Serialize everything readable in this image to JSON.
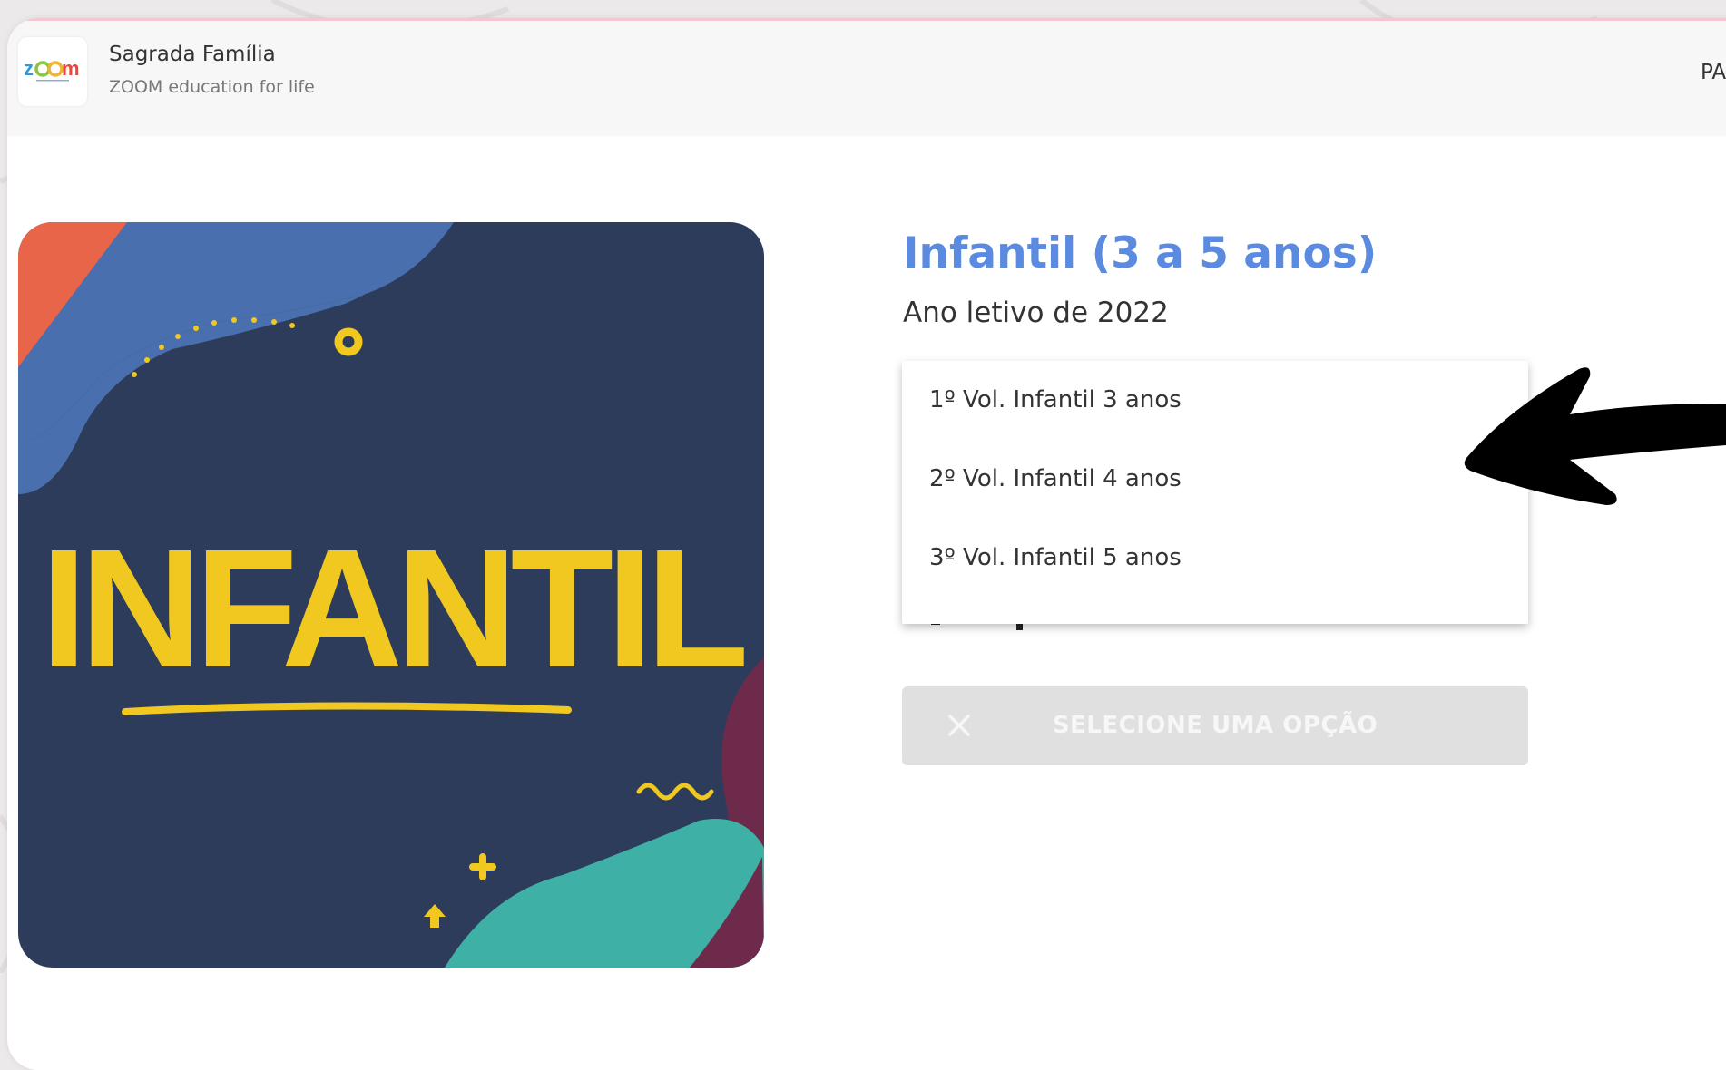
{
  "header": {
    "school_name": "Sagrada Família",
    "tagline": "ZOOM education for life",
    "right_text": "PA",
    "logo_text": "zoom",
    "logo_colors": [
      "#2e9bd6",
      "#8bc53f",
      "#f2b233",
      "#e8473c"
    ]
  },
  "cover": {
    "label": "INFANTIL",
    "colors": {
      "background": "#2e3c5c",
      "blue_wave": "#4a6fae",
      "orange_corner": "#e8654a",
      "teal_wave": "#3fb0a5",
      "maroon_wave": "#6e2a4a",
      "yellow": "#f0c81f"
    }
  },
  "product": {
    "title": "Infantil (3 a 5 anos)",
    "subtitle": "Ano letivo de 2022",
    "title_color": "#5b8be0"
  },
  "dropdown": {
    "options": [
      "1º Vol. Infantil 3 anos",
      "2º Vol. Infantil 4 anos",
      "3º Vol. Infantil 5 anos"
    ]
  },
  "action": {
    "label": "SELECIONE UMA OPÇÃO",
    "icon": "close-icon"
  },
  "annotation": {
    "icon": "arrow-pointer-icon",
    "color": "#000000"
  }
}
